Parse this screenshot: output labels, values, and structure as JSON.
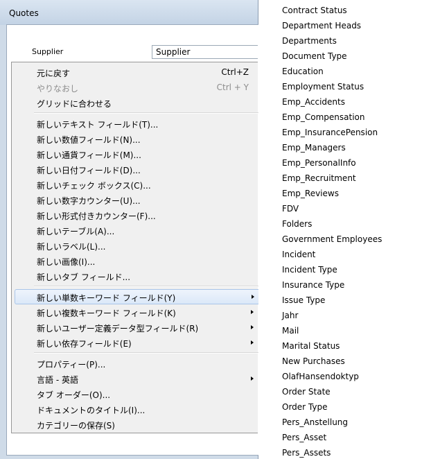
{
  "window": {
    "title": "Quotes"
  },
  "form": {
    "supplier_label": "Supplier",
    "supplier_value": "Supplier"
  },
  "menu": {
    "groups": [
      [
        {
          "label": "元に戻す",
          "shortcut": "Ctrl+Z",
          "disabled": false
        },
        {
          "label": "やりなおし",
          "shortcut": "Ctrl + Y",
          "disabled": true
        },
        {
          "label": "グリッドに合わせる",
          "shortcut": "",
          "disabled": false
        }
      ],
      [
        {
          "label": "新しいテキスト フィールド(T)..."
        },
        {
          "label": "新しい数値フィールド(N)..."
        },
        {
          "label": "新しい通貨フィールド(M)..."
        },
        {
          "label": "新しい日付フィールド(D)..."
        },
        {
          "label": "新しいチェック ボックス(C)..."
        },
        {
          "label": "新しい数字カウンター(U)..."
        },
        {
          "label": "新しい形式付きカウンター(F)..."
        },
        {
          "label": "新しいテーブル(A)..."
        },
        {
          "label": "新しいラベル(L)..."
        },
        {
          "label": "新しい画像(I)..."
        },
        {
          "label": "新しいタブ フィールド..."
        }
      ],
      [
        {
          "label": "新しい単数キーワード フィールド(Y)",
          "submenu": true,
          "highlight": true
        },
        {
          "label": "新しい複数キーワード フィールド(K)",
          "submenu": true
        },
        {
          "label": "新しいユーザー定義データ型フィールド(R)",
          "submenu": true
        },
        {
          "label": "新しい依存フィールド(E)",
          "submenu": true
        }
      ],
      [
        {
          "label": "プロパティー(P)..."
        },
        {
          "label": "言語 - 英語",
          "submenu": true
        },
        {
          "label": "タブ オーダー(O)..."
        },
        {
          "label": "ドキュメントのタイトル(I)..."
        },
        {
          "label": "カテゴリーの保存(S)"
        }
      ]
    ]
  },
  "keyword_list": [
    "Contract Status",
    "Department Heads",
    "Departments",
    "Document Type",
    "Education",
    "Employment Status",
    "Emp_Accidents",
    "Emp_Compensation",
    "Emp_InsurancePension",
    "Emp_Managers",
    "Emp_PersonalInfo",
    "Emp_Recruitment",
    "Emp_Reviews",
    "FDV",
    "Folders",
    "Government Employees",
    "Incident",
    "Incident Type",
    "Insurance Type",
    "Issue Type",
    "Jahr",
    "Mail",
    "Marital Status",
    "New Purchases",
    "OlafHansendoktyp",
    "Order State",
    "Order Type",
    "Pers_Anstellung",
    "Pers_Asset",
    "Pers_Assets"
  ]
}
